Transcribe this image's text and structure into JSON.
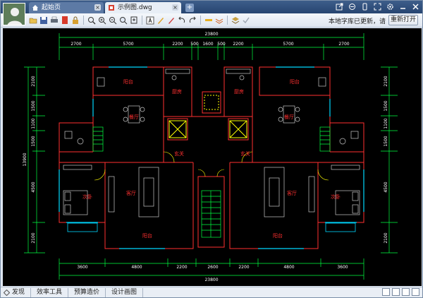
{
  "tabs": [
    {
      "label": "起始页"
    },
    {
      "label": "示例图.dwg"
    }
  ],
  "toolbar": {
    "notice": "本地字库已更新，请",
    "reopen_label": "重新打开"
  },
  "drawing": {
    "dim_top_total": "23800",
    "dim_top": [
      "2700",
      "5700",
      "2200",
      "500",
      "1600",
      "500",
      "2200",
      "5700",
      "2700"
    ],
    "dim_bottom": [
      "3600",
      "4800",
      "2200",
      "2600",
      "2200",
      "4800",
      "3600"
    ],
    "dim_bottom_total": "23800",
    "dim_left": [
      "2100",
      "1500",
      "1100",
      "1500",
      "4500",
      "2100"
    ],
    "dim_left_total": "13900",
    "dim_right": [
      "2100",
      "1500",
      "1100",
      "1500",
      "4500",
      "2100"
    ],
    "room_labels": {
      "balcony_top_left": "阳台",
      "kitchen_left": "厨房",
      "kitchen_right": "厨房",
      "balcony_top_right": "阳台",
      "dining_left": "餐厅",
      "dining_right": "餐厅",
      "foyer_left": "玄关",
      "foyer_right": "玄关",
      "living_left": "客厅",
      "living_right": "客厅",
      "bedroom_left": "次卧",
      "bedroom_right": "次卧",
      "balcony_bottom_left": "阳台",
      "balcony_bottom_right": "阳台"
    },
    "colors": {
      "background": "#000000",
      "wall": "#ff3030",
      "dimension": "#00ff40",
      "label": "#ff3030",
      "furniture": "#c8c8c8",
      "window": "#00d8ff",
      "elevator": "#ffff00"
    }
  },
  "statusbar": {
    "items": [
      "发现",
      "效率工具",
      "预算造价",
      "设计画图"
    ]
  }
}
